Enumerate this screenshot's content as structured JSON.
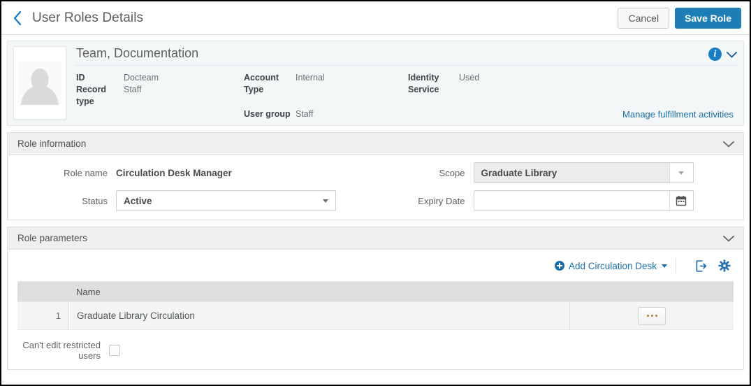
{
  "topbar": {
    "back_icon": "chevron-left-icon",
    "title": "User Roles Details",
    "cancel_label": "Cancel",
    "save_label": "Save Role",
    "primary_color": "#1d7db5"
  },
  "banner": {
    "avatar_icon": "user-placeholder-icon",
    "user_name": "Team, Documentation",
    "info_icon": "info-icon",
    "collapse_icon": "chevron-down-icon",
    "fields": [
      {
        "label": "ID",
        "value": "Docteam"
      },
      {
        "label": "Record type",
        "value": "Staff"
      },
      {
        "label": "Account Type",
        "value": "Internal"
      },
      {
        "label": "User group",
        "value": "Staff"
      },
      {
        "label": "Identity Service",
        "value": "Used"
      }
    ],
    "manage_link": "Manage fulfillment activities"
  },
  "role_information": {
    "title": "Role information",
    "collapse_icon": "chevron-down-icon",
    "role_name_label": "Role name",
    "role_name_value": "Circulation Desk Manager",
    "status_label": "Status",
    "status_value": "Active",
    "scope_label": "Scope",
    "scope_value": "Graduate Library",
    "expiry_label": "Expiry Date",
    "expiry_value": "",
    "expiry_placeholder": "",
    "calendar_icon": "calendar-icon"
  },
  "role_parameters": {
    "title": "Role parameters",
    "collapse_icon": "chevron-down-icon",
    "add_label": "Add Circulation Desk",
    "add_icon": "plus-circle-icon",
    "add_caret_icon": "caret-down-icon",
    "export_icon": "export-icon",
    "settings_icon": "gear-icon",
    "columns": [
      "",
      "Name",
      ""
    ],
    "rows": [
      {
        "num": "1",
        "name": "Graduate Library Circulation",
        "action_icon": "ellipsis-icon"
      }
    ],
    "checkbox_label": "Can't edit restricted users",
    "checkbox_checked": false
  }
}
